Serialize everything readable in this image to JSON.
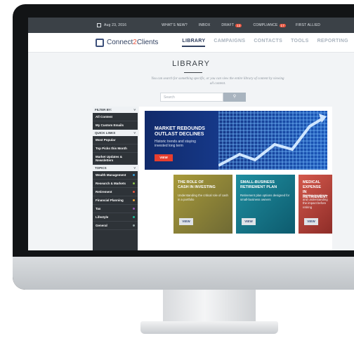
{
  "topbar": {
    "date": "Aug 23, 2016",
    "items": [
      "WHAT'S NEW?",
      "INBOX",
      "DRAFT",
      "COMPLIANCE",
      "FIRST ALLIED"
    ],
    "draft_badge": "13",
    "compliance_badge": "17"
  },
  "header": {
    "logo_pre": "Connect",
    "logo_num": "2",
    "logo_post": "Clients",
    "nav": [
      "LIBRARY",
      "CAMPAIGNS",
      "CONTACTS",
      "TOOLS",
      "REPORTING"
    ]
  },
  "page": {
    "title": "LIBRARY",
    "intro": "You can search for something specific, or you can view the entire library of content by viewing all content.",
    "search_placeholder": "Search"
  },
  "sidebar": {
    "filter_label": "FILTER BY:",
    "filter_items": [
      "All Content",
      "My Custom Emails"
    ],
    "quick_label": "QUICK LINKS",
    "quick_items": [
      "Most Popular",
      "Top Picks this Month",
      "Market Updates & Newsletters"
    ],
    "topics_label": "TOPICS",
    "topics": [
      "Wealth Management",
      "Research & Markets",
      "Retirement",
      "Financial Planning",
      "Tax",
      "Lifestyle",
      "General"
    ],
    "topic_colors": [
      "#3aa0d8",
      "#8bc34a",
      "#e9543e",
      "#f2a93b",
      "#9b59b6",
      "#1abc9c",
      "#95a5a6"
    ]
  },
  "hero": {
    "title_line1": "MARKET REBOUNDS",
    "title_line2": "OUTLAST DECLINES",
    "subtitle": "Historic trends and staying invested long term",
    "button": "VIEW"
  },
  "cards": [
    {
      "title_line1": "THE ROLE OF",
      "title_line2": "CASH IN INVESTING",
      "subtitle": "Understanding the critical role of cash in a portfolio",
      "button": "VIEW"
    },
    {
      "title_line1": "SMALL-BUSINESS",
      "title_line2": "RETIREMENT PLAN",
      "subtitle": "Retirement plan options designed for small-business owners",
      "button": "VIEW"
    },
    {
      "title_line1": "MEDICAL EXPENSE",
      "title_line2": "IN RETIREMENT",
      "subtitle": "Raising questions and understanding the impact before retiring",
      "button": "VIEW"
    }
  ],
  "colors": {
    "brand_navy": "#2f3f5f",
    "accent_red": "#e73e2e",
    "topbar": "#3b4147"
  }
}
